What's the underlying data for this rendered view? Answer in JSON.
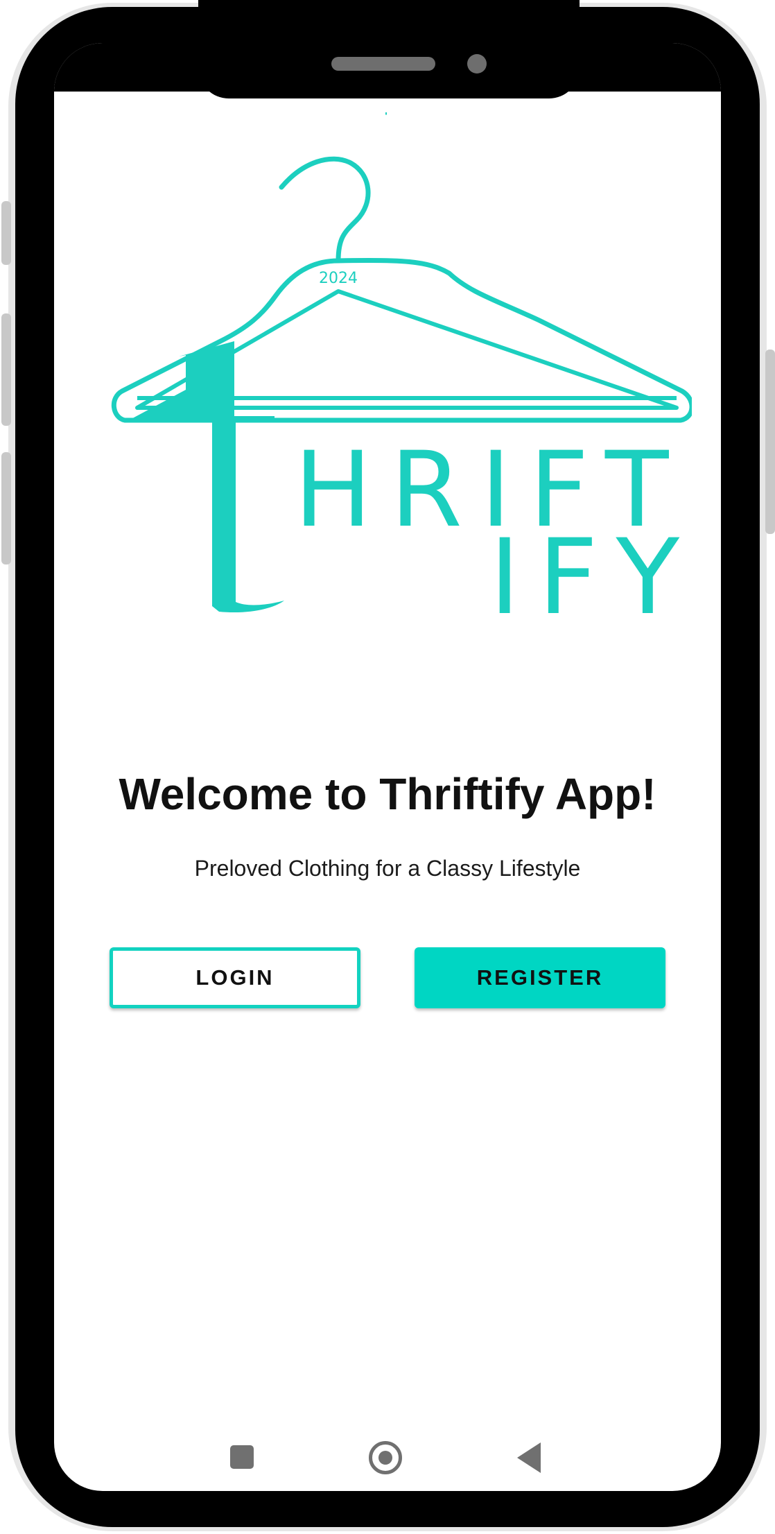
{
  "brand": {
    "logo_word_top": "HRIFT",
    "logo_word_bottom": "IFY",
    "logo_initial": "t",
    "logo_year": "2024",
    "accent_color": "#00d6c3"
  },
  "welcome": {
    "title": "Welcome to Thriftify App!",
    "subtitle": "Preloved Clothing for a Classy Lifestyle"
  },
  "actions": {
    "login_label": "LOGIN",
    "register_label": "REGISTER"
  },
  "nav": {
    "recents_icon": "square-icon",
    "home_icon": "circle-home-icon",
    "back_icon": "triangle-back-icon"
  }
}
